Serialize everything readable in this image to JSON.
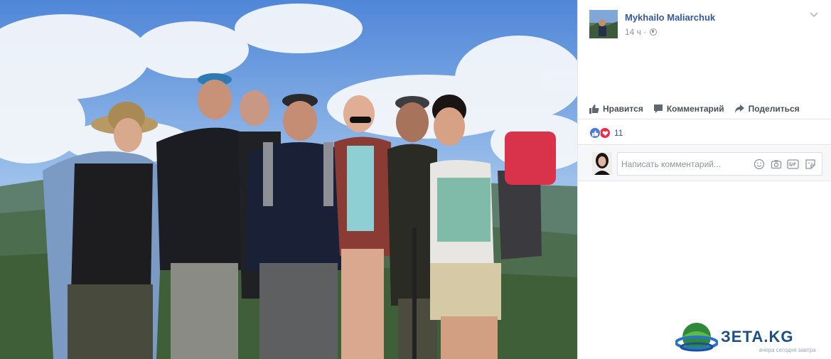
{
  "post": {
    "author": "Mykhailo Maliarchuk",
    "time": "14 ч",
    "dot": "·"
  },
  "actions": {
    "like": "Нравится",
    "comment": "Комментарий",
    "share": "Поделиться"
  },
  "reactions": {
    "count": "11",
    "types": [
      "like",
      "love"
    ]
  },
  "comment_box": {
    "placeholder": "Написать комментарий..."
  },
  "icons": [
    "chevron-down-icon",
    "globe-icon",
    "thumbs-up-icon",
    "comment-icon",
    "share-icon",
    "emoji-icon",
    "camera-icon",
    "gif-icon",
    "sticker-icon"
  ],
  "watermark": {
    "brand": "ЗЕТА.KG",
    "tagline": "вчера сегодня завтра"
  },
  "colors": {
    "link": "#365899",
    "secondary_text": "#90949c",
    "action_text": "#4b4f56",
    "like_blue": "#4a7ad8",
    "love_red": "#f0284a"
  }
}
